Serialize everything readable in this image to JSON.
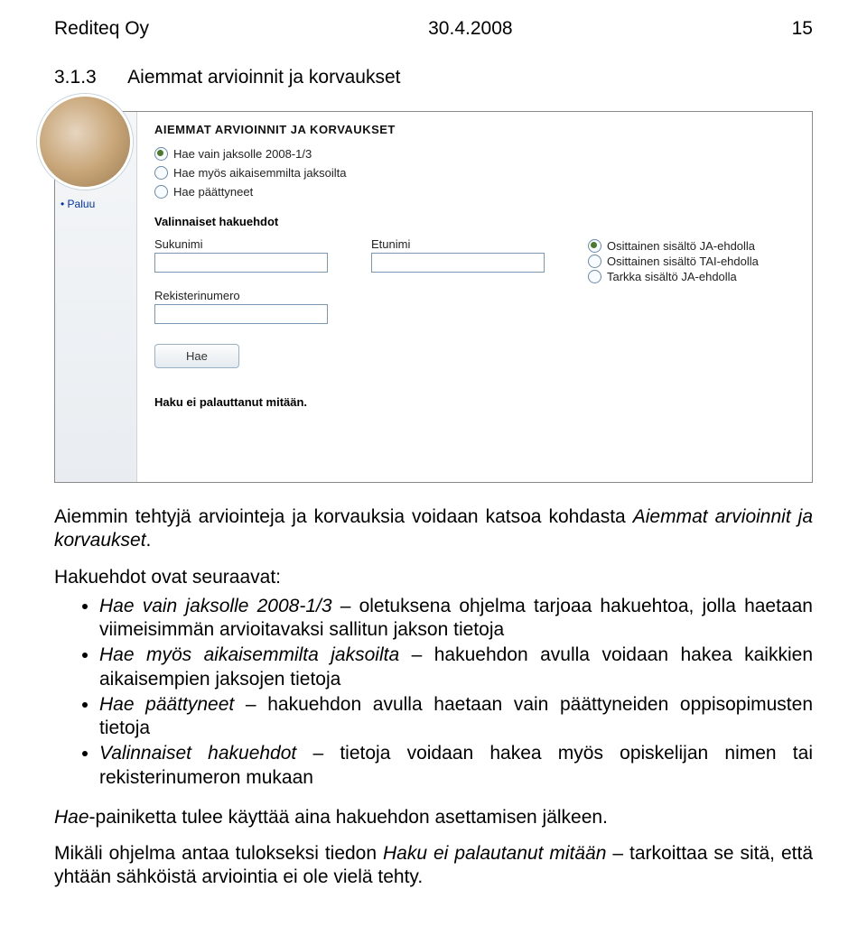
{
  "header": {
    "company": "Rediteq Oy",
    "date": "30.4.2008",
    "page": "15"
  },
  "section": {
    "number": "3.1.3",
    "title": "Aiemmat arvioinnit ja korvaukset"
  },
  "screenshot": {
    "back_link": "Paluu",
    "heading": "AIEMMAT ARVIOINNIT JA KORVAUKSET",
    "period_options": {
      "opt1": "Hae vain jaksolle 2008-1/3",
      "opt2": "Hae myös aikaisemmilta jaksoilta",
      "opt3": "Hae päättyneet"
    },
    "optional_heading": "Valinnaiset hakuehdot",
    "labels": {
      "surname": "Sukunimi",
      "firstname": "Etunimi",
      "regnum": "Rekisterinumero"
    },
    "match_options": {
      "m1": "Osittainen sisältö JA-ehdolla",
      "m2": "Osittainen sisältö TAI-ehdolla",
      "m3": "Tarkka sisältö JA-ehdolla"
    },
    "search_button": "Hae",
    "no_result": "Haku ei palauttanut mitään."
  },
  "intro": "Aiemmin tehtyjä arviointeja ja korvauksia voidaan katsoa kohdasta Aiemmat arvioinnit ja korvaukset.",
  "list_intro": "Hakuehdot ovat seuraavat:",
  "bullets": {
    "b1a": "Hae vain jaksolle 2008-1/3",
    "b1b": " – oletuksena ohjelma tarjoaa hakuehtoa, jolla haetaan viimeisimmän arvioitavaksi sallitun jakson tietoja",
    "b2a": "Hae myös aikaisemmilta jaksoilta",
    "b2b": " – hakuehdon avulla voidaan hakea kaikkien aikaisempien jaksojen tietoja",
    "b3a": "Hae päättyneet",
    "b3b": " – hakuehdon avulla haetaan vain päättyneiden oppisopimusten tietoja",
    "b4a": "Valinnaiset hakuehdot",
    "b4b": " – tietoja voidaan hakea myös opiskelijan nimen tai rekisterinumeron mukaan"
  },
  "after1a": "Hae",
  "after1b": "-painiketta tulee käyttää aina hakuehdon asettamisen jälkeen.",
  "after2a": "Mikäli ohjelma antaa tulokseksi tiedon ",
  "after2b": "Haku ei palautanut mitään",
  "after2c": " – tarkoittaa se sitä, että yhtään sähköistä arviointia ei ole vielä tehty."
}
